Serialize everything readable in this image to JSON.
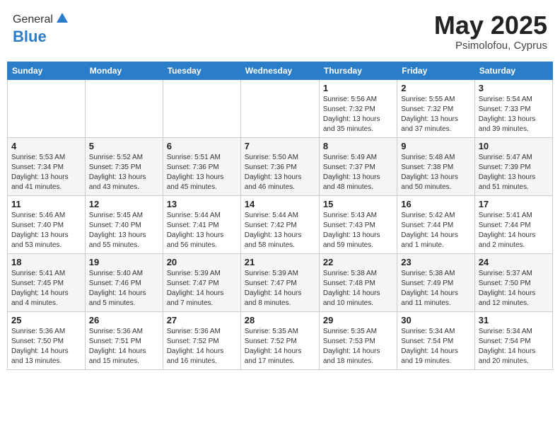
{
  "header": {
    "logo_general": "General",
    "logo_blue": "Blue",
    "month": "May 2025",
    "location": "Psimolofou, Cyprus"
  },
  "weekdays": [
    "Sunday",
    "Monday",
    "Tuesday",
    "Wednesday",
    "Thursday",
    "Friday",
    "Saturday"
  ],
  "weeks": [
    [
      {
        "day": "",
        "info": ""
      },
      {
        "day": "",
        "info": ""
      },
      {
        "day": "",
        "info": ""
      },
      {
        "day": "",
        "info": ""
      },
      {
        "day": "1",
        "info": "Sunrise: 5:56 AM\nSunset: 7:32 PM\nDaylight: 13 hours\nand 35 minutes."
      },
      {
        "day": "2",
        "info": "Sunrise: 5:55 AM\nSunset: 7:32 PM\nDaylight: 13 hours\nand 37 minutes."
      },
      {
        "day": "3",
        "info": "Sunrise: 5:54 AM\nSunset: 7:33 PM\nDaylight: 13 hours\nand 39 minutes."
      }
    ],
    [
      {
        "day": "4",
        "info": "Sunrise: 5:53 AM\nSunset: 7:34 PM\nDaylight: 13 hours\nand 41 minutes."
      },
      {
        "day": "5",
        "info": "Sunrise: 5:52 AM\nSunset: 7:35 PM\nDaylight: 13 hours\nand 43 minutes."
      },
      {
        "day": "6",
        "info": "Sunrise: 5:51 AM\nSunset: 7:36 PM\nDaylight: 13 hours\nand 45 minutes."
      },
      {
        "day": "7",
        "info": "Sunrise: 5:50 AM\nSunset: 7:36 PM\nDaylight: 13 hours\nand 46 minutes."
      },
      {
        "day": "8",
        "info": "Sunrise: 5:49 AM\nSunset: 7:37 PM\nDaylight: 13 hours\nand 48 minutes."
      },
      {
        "day": "9",
        "info": "Sunrise: 5:48 AM\nSunset: 7:38 PM\nDaylight: 13 hours\nand 50 minutes."
      },
      {
        "day": "10",
        "info": "Sunrise: 5:47 AM\nSunset: 7:39 PM\nDaylight: 13 hours\nand 51 minutes."
      }
    ],
    [
      {
        "day": "11",
        "info": "Sunrise: 5:46 AM\nSunset: 7:40 PM\nDaylight: 13 hours\nand 53 minutes."
      },
      {
        "day": "12",
        "info": "Sunrise: 5:45 AM\nSunset: 7:40 PM\nDaylight: 13 hours\nand 55 minutes."
      },
      {
        "day": "13",
        "info": "Sunrise: 5:44 AM\nSunset: 7:41 PM\nDaylight: 13 hours\nand 56 minutes."
      },
      {
        "day": "14",
        "info": "Sunrise: 5:44 AM\nSunset: 7:42 PM\nDaylight: 13 hours\nand 58 minutes."
      },
      {
        "day": "15",
        "info": "Sunrise: 5:43 AM\nSunset: 7:43 PM\nDaylight: 13 hours\nand 59 minutes."
      },
      {
        "day": "16",
        "info": "Sunrise: 5:42 AM\nSunset: 7:44 PM\nDaylight: 14 hours\nand 1 minute."
      },
      {
        "day": "17",
        "info": "Sunrise: 5:41 AM\nSunset: 7:44 PM\nDaylight: 14 hours\nand 2 minutes."
      }
    ],
    [
      {
        "day": "18",
        "info": "Sunrise: 5:41 AM\nSunset: 7:45 PM\nDaylight: 14 hours\nand 4 minutes."
      },
      {
        "day": "19",
        "info": "Sunrise: 5:40 AM\nSunset: 7:46 PM\nDaylight: 14 hours\nand 5 minutes."
      },
      {
        "day": "20",
        "info": "Sunrise: 5:39 AM\nSunset: 7:47 PM\nDaylight: 14 hours\nand 7 minutes."
      },
      {
        "day": "21",
        "info": "Sunrise: 5:39 AM\nSunset: 7:47 PM\nDaylight: 14 hours\nand 8 minutes."
      },
      {
        "day": "22",
        "info": "Sunrise: 5:38 AM\nSunset: 7:48 PM\nDaylight: 14 hours\nand 10 minutes."
      },
      {
        "day": "23",
        "info": "Sunrise: 5:38 AM\nSunset: 7:49 PM\nDaylight: 14 hours\nand 11 minutes."
      },
      {
        "day": "24",
        "info": "Sunrise: 5:37 AM\nSunset: 7:50 PM\nDaylight: 14 hours\nand 12 minutes."
      }
    ],
    [
      {
        "day": "25",
        "info": "Sunrise: 5:36 AM\nSunset: 7:50 PM\nDaylight: 14 hours\nand 13 minutes."
      },
      {
        "day": "26",
        "info": "Sunrise: 5:36 AM\nSunset: 7:51 PM\nDaylight: 14 hours\nand 15 minutes."
      },
      {
        "day": "27",
        "info": "Sunrise: 5:36 AM\nSunset: 7:52 PM\nDaylight: 14 hours\nand 16 minutes."
      },
      {
        "day": "28",
        "info": "Sunrise: 5:35 AM\nSunset: 7:52 PM\nDaylight: 14 hours\nand 17 minutes."
      },
      {
        "day": "29",
        "info": "Sunrise: 5:35 AM\nSunset: 7:53 PM\nDaylight: 14 hours\nand 18 minutes."
      },
      {
        "day": "30",
        "info": "Sunrise: 5:34 AM\nSunset: 7:54 PM\nDaylight: 14 hours\nand 19 minutes."
      },
      {
        "day": "31",
        "info": "Sunrise: 5:34 AM\nSunset: 7:54 PM\nDaylight: 14 hours\nand 20 minutes."
      }
    ]
  ]
}
